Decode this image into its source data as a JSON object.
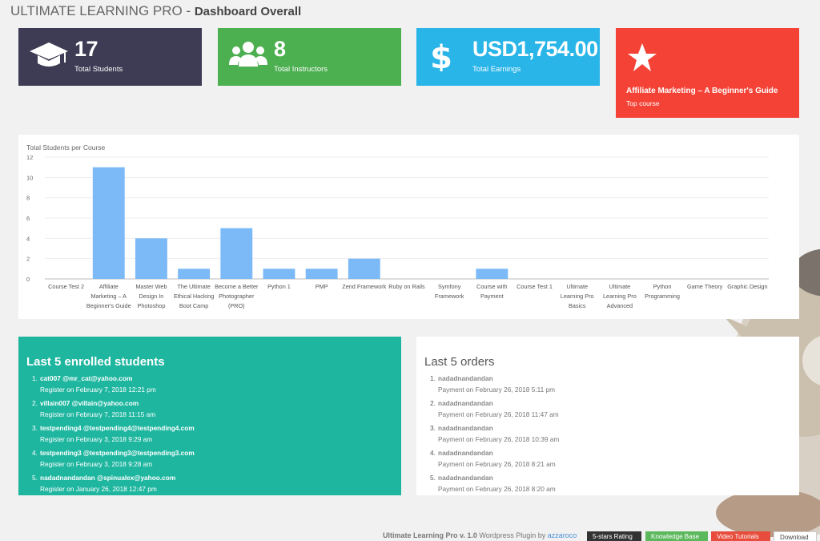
{
  "header": {
    "app_name": "ULTIMATE LEARNING PRO",
    "separator": " - ",
    "page_title": "Dashboard Overall"
  },
  "stats": {
    "students": {
      "value": "17",
      "label": "Total Students",
      "icon": "graduation-cap-icon",
      "color": "#3d3c54"
    },
    "instructors": {
      "value": "8",
      "label": "Total Instructors",
      "icon": "users-icon",
      "color": "#4caf50"
    },
    "earnings": {
      "value": "USD1,754.00",
      "label": "Total Earnings",
      "icon": "dollar-icon",
      "color": "#29b5e8"
    },
    "top_course": {
      "value": "Affiliate Marketing – A Beginner's Guide",
      "label": "Top course",
      "icon": "star-icon",
      "color": "#f44336"
    }
  },
  "chart_data": {
    "type": "bar",
    "title": "Total Students per Course",
    "categories": [
      "Course Test 2",
      "Affiliate Marketing – A Beginner's Guide",
      "Master Web Design In Photoshop",
      "The Ultimate Ethical Hacking Boot Camp",
      "Become a Better Photographer (PRO)",
      "Python 1",
      "PMP",
      "Zend Framework",
      "Ruby on Rails",
      "Symfony Framework",
      "Course with Payment",
      "Course Test 1",
      "Ultimate Learning Pro Basics",
      "Ultimate Learning Pro Advanced",
      "Python Programming",
      "Game Theory",
      "Graphic Design"
    ],
    "category_lines": [
      [
        "Course Test 2"
      ],
      [
        "Affiliate",
        "Marketing – A",
        "Beginner's Guide"
      ],
      [
        "Master Web",
        "Design In",
        "Photoshop"
      ],
      [
        "The Ultimate",
        "Ethical Hacking",
        "Boot Camp"
      ],
      [
        "Become a Better",
        "Photographer",
        "(PRO)"
      ],
      [
        "Python 1"
      ],
      [
        "PMP"
      ],
      [
        "Zend Framework"
      ],
      [
        "Ruby on Rails"
      ],
      [
        "Symfony",
        "Framework"
      ],
      [
        "Course with",
        "Payment"
      ],
      [
        "Course Test 1"
      ],
      [
        "Ultimate",
        "Learning Pro",
        "Basics"
      ],
      [
        "Ultimate",
        "Learning Pro",
        "Advanced"
      ],
      [
        "Python",
        "Programming"
      ],
      [
        "Game Theory"
      ],
      [
        "Graphic Design"
      ]
    ],
    "values": [
      0,
      11,
      4,
      1,
      5,
      1,
      1,
      2,
      0,
      0,
      1,
      0,
      0,
      0,
      0,
      0,
      0
    ],
    "ylim": [
      0,
      12
    ],
    "yticks": [
      0,
      2,
      4,
      6,
      8,
      10,
      12
    ],
    "grid": true,
    "bar_color": "#7cb9f7"
  },
  "enrolled": {
    "title": "Last 5 enrolled students",
    "items": [
      {
        "num": "1.",
        "name": "cat007 @mr_cat@yahoo.com",
        "meta": "Register on February 7, 2018 12:21 pm"
      },
      {
        "num": "2.",
        "name": "villain007 @villain@yahoo.com",
        "meta": "Register on February 7, 2018 11:15 am"
      },
      {
        "num": "3.",
        "name": "testpending4 @testpending4@testpending4.com",
        "meta": "Register on February 3, 2018 9:29 am"
      },
      {
        "num": "4.",
        "name": "testpending3 @testpending3@testpending3.com",
        "meta": "Register on February 3, 2018 9:28 am"
      },
      {
        "num": "5.",
        "name": "nadadnandandan @spinualex@yahoo.com",
        "meta": "Register on January 26, 2018 12:47 pm"
      }
    ]
  },
  "orders": {
    "title": "Last 5 orders",
    "items": [
      {
        "num": "1.",
        "name": "nadadnandandan",
        "meta": "Payment on February 26, 2018 5:11 pm"
      },
      {
        "num": "2.",
        "name": "nadadnandandan",
        "meta": "Payment on February 26, 2018 11:47 am"
      },
      {
        "num": "3.",
        "name": "nadadnandandan",
        "meta": "Payment on February 26, 2018 10:39 am"
      },
      {
        "num": "4.",
        "name": "nadadnandandan",
        "meta": "Payment on February 26, 2018 8:21 am"
      },
      {
        "num": "5.",
        "name": "nadadnandandan",
        "meta": "Payment on February 26, 2018 8:20 am"
      }
    ]
  },
  "footer": {
    "plugin_text": "Ultimate Learning Pro v. 1.0",
    "wp_text": " Wordpress Plugin by ",
    "author": "azzaroco",
    "buttons": {
      "rating": "5-stars Rating",
      "knowledge": "Knowledge Base",
      "video": "Video Tutorials",
      "download": "Download"
    }
  }
}
